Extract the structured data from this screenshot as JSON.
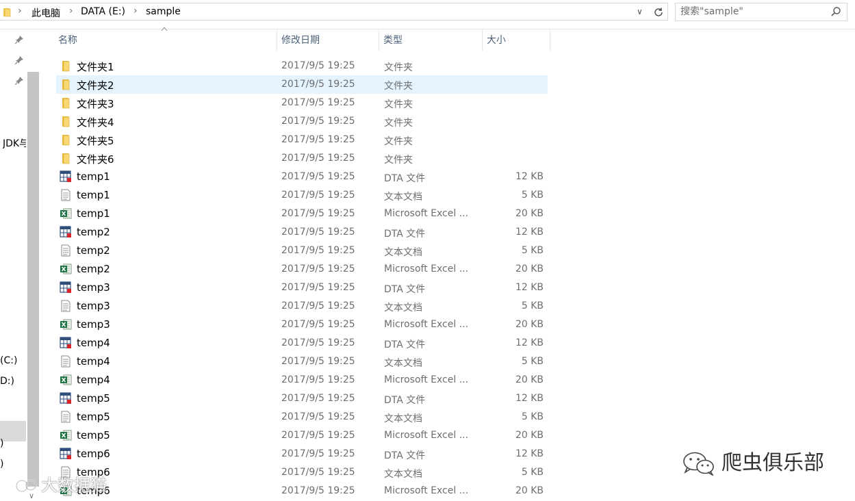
{
  "address_bar": {
    "breadcrumbs": [
      "此电脑",
      "DATA (E:)",
      "sample"
    ],
    "search_placeholder": "搜索\"sample\""
  },
  "nav_pane": {
    "labels": {
      "jdk": "JDK与",
      "drive_c": "(C:)",
      "drive_d": "D:)",
      "paren1": ")",
      "paren2": ")"
    }
  },
  "columns": {
    "name": "名称",
    "date": "修改日期",
    "type": "类型",
    "size": "大小"
  },
  "files": [
    {
      "name": "文件夹1",
      "date": "2017/9/5 19:25",
      "type": "文件夹",
      "size": "",
      "icon": "folder-icon"
    },
    {
      "name": "文件夹2",
      "date": "2017/9/5 19:25",
      "type": "文件夹",
      "size": "",
      "icon": "folder-icon",
      "selected": true
    },
    {
      "name": "文件夹3",
      "date": "2017/9/5 19:25",
      "type": "文件夹",
      "size": "",
      "icon": "folder-icon"
    },
    {
      "name": "文件夹4",
      "date": "2017/9/5 19:25",
      "type": "文件夹",
      "size": "",
      "icon": "folder-icon"
    },
    {
      "name": "文件夹5",
      "date": "2017/9/5 19:25",
      "type": "文件夹",
      "size": "",
      "icon": "folder-icon"
    },
    {
      "name": "文件夹6",
      "date": "2017/9/5 19:25",
      "type": "文件夹",
      "size": "",
      "icon": "folder-icon"
    },
    {
      "name": "temp1",
      "date": "2017/9/5 19:25",
      "type": "DTA 文件",
      "size": "12 KB",
      "icon": "dta-file-icon"
    },
    {
      "name": "temp1",
      "date": "2017/9/5 19:25",
      "type": "文本文档",
      "size": "5 KB",
      "icon": "text-file-icon"
    },
    {
      "name": "temp1",
      "date": "2017/9/5 19:25",
      "type": "Microsoft Excel ...",
      "size": "20 KB",
      "icon": "excel-file-icon"
    },
    {
      "name": "temp2",
      "date": "2017/9/5 19:25",
      "type": "DTA 文件",
      "size": "12 KB",
      "icon": "dta-file-icon"
    },
    {
      "name": "temp2",
      "date": "2017/9/5 19:25",
      "type": "文本文档",
      "size": "5 KB",
      "icon": "text-file-icon"
    },
    {
      "name": "temp2",
      "date": "2017/9/5 19:25",
      "type": "Microsoft Excel ...",
      "size": "20 KB",
      "icon": "excel-file-icon"
    },
    {
      "name": "temp3",
      "date": "2017/9/5 19:25",
      "type": "DTA 文件",
      "size": "12 KB",
      "icon": "dta-file-icon"
    },
    {
      "name": "temp3",
      "date": "2017/9/5 19:25",
      "type": "文本文档",
      "size": "5 KB",
      "icon": "text-file-icon"
    },
    {
      "name": "temp3",
      "date": "2017/9/5 19:25",
      "type": "Microsoft Excel ...",
      "size": "20 KB",
      "icon": "excel-file-icon"
    },
    {
      "name": "temp4",
      "date": "2017/9/5 19:25",
      "type": "DTA 文件",
      "size": "12 KB",
      "icon": "dta-file-icon"
    },
    {
      "name": "temp4",
      "date": "2017/9/5 19:25",
      "type": "文本文档",
      "size": "5 KB",
      "icon": "text-file-icon"
    },
    {
      "name": "temp4",
      "date": "2017/9/5 19:25",
      "type": "Microsoft Excel ...",
      "size": "20 KB",
      "icon": "excel-file-icon"
    },
    {
      "name": "temp5",
      "date": "2017/9/5 19:25",
      "type": "DTA 文件",
      "size": "12 KB",
      "icon": "dta-file-icon"
    },
    {
      "name": "temp5",
      "date": "2017/9/5 19:25",
      "type": "文本文档",
      "size": "5 KB",
      "icon": "text-file-icon"
    },
    {
      "name": "temp5",
      "date": "2017/9/5 19:25",
      "type": "Microsoft Excel ...",
      "size": "20 KB",
      "icon": "excel-file-icon"
    },
    {
      "name": "temp6",
      "date": "2017/9/5 19:25",
      "type": "DTA 文件",
      "size": "12 KB",
      "icon": "dta-file-icon"
    },
    {
      "name": "temp6",
      "date": "2017/9/5 19:25",
      "type": "文本文档",
      "size": "5 KB",
      "icon": "text-file-icon"
    },
    {
      "name": "temp6",
      "date": "2017/9/5 19:25",
      "type": "Microsoft Excel ...",
      "size": "20 KB",
      "icon": "excel-file-icon"
    }
  ],
  "watermarks": {
    "right": "爬虫俱乐部",
    "left": "大数据猫"
  },
  "colors": {
    "selection": "#e5f3ff",
    "header_text": "#4c607a",
    "muted_text": "#6d6d6d",
    "folder": "#f8d775"
  }
}
